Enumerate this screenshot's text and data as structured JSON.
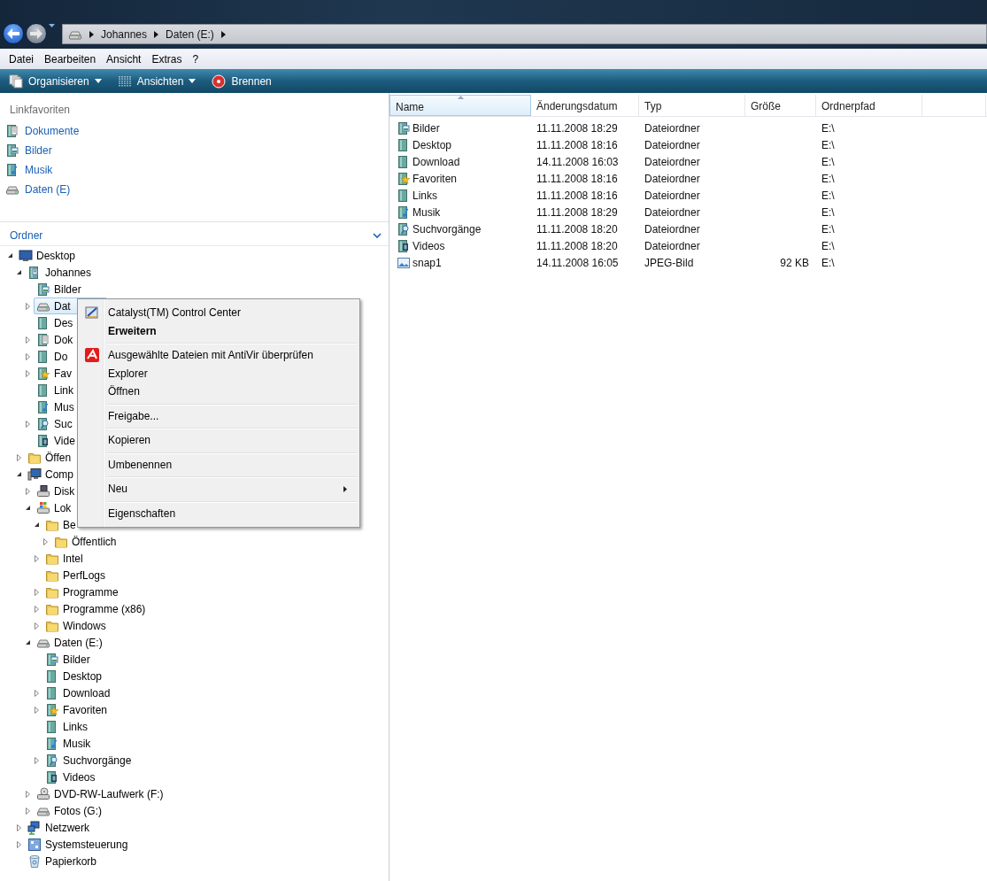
{
  "address_bar": {
    "crumbs": [
      "Johannes",
      "Daten (E:)"
    ]
  },
  "menu_bar": [
    "Datei",
    "Bearbeiten",
    "Ansicht",
    "Extras",
    "?"
  ],
  "toolbar": [
    {
      "label": "Organisieren",
      "kind": "organize",
      "dropdown": true
    },
    {
      "label": "Ansichten",
      "kind": "views",
      "dropdown": true
    },
    {
      "label": "Brennen",
      "kind": "burn",
      "dropdown": false
    }
  ],
  "favorite_links": {
    "title": "Linkfavoriten",
    "items": [
      {
        "label": "Dokumente",
        "kind": "docs"
      },
      {
        "label": "Bilder",
        "kind": "pictures"
      },
      {
        "label": "Musik",
        "kind": "music"
      },
      {
        "label": "Daten (E)",
        "kind": "drive"
      }
    ]
  },
  "folders": {
    "title": "Ordner",
    "tree": [
      {
        "label": "Desktop",
        "kind": "desktop",
        "expanded": true,
        "selected": false,
        "children": [
          {
            "label": "Johannes",
            "kind": "user",
            "expanded": true,
            "selected": false,
            "children": [
              {
                "label": "Bilder",
                "kind": "pictures",
                "selected": false
              },
              {
                "label": "Dat",
                "kind": "drive",
                "expanded": false,
                "selected": true
              },
              {
                "label": "Des",
                "kind": "library",
                "selected": false
              },
              {
                "label": "Dok",
                "kind": "docs",
                "expanded": false,
                "selected": false
              },
              {
                "label": "Do",
                "kind": "library",
                "expanded": false,
                "selected": false
              },
              {
                "label": "Fav",
                "kind": "favorites",
                "expanded": false,
                "selected": false
              },
              {
                "label": "Link",
                "kind": "library",
                "selected": false
              },
              {
                "label": "Mus",
                "kind": "music",
                "selected": false
              },
              {
                "label": "Suc",
                "kind": "search",
                "expanded": false,
                "selected": false
              },
              {
                "label": "Vide",
                "kind": "video",
                "selected": false
              }
            ]
          },
          {
            "label": "Öffen",
            "kind": "folder",
            "expanded": false,
            "selected": false
          },
          {
            "label": "Comp",
            "kind": "computer",
            "expanded": true,
            "selected": false,
            "children": [
              {
                "label": "Disk",
                "kind": "floppy",
                "expanded": false,
                "selected": false
              },
              {
                "label": "Lok",
                "kind": "windrive",
                "expanded": true,
                "selected": false,
                "children": [
                  {
                    "label": "Be",
                    "kind": "folder",
                    "expanded": true,
                    "selected": false,
                    "children": [
                      {
                        "label": "Öffentlich",
                        "kind": "folder",
                        "expanded": false,
                        "selected": false
                      }
                    ]
                  },
                  {
                    "label": "Intel",
                    "kind": "folder",
                    "expanded": false,
                    "selected": false
                  },
                  {
                    "label": "PerfLogs",
                    "kind": "folder",
                    "selected": false
                  },
                  {
                    "label": "Programme",
                    "kind": "folder",
                    "expanded": false,
                    "selected": false
                  },
                  {
                    "label": "Programme (x86)",
                    "kind": "folder",
                    "expanded": false,
                    "selected": false
                  },
                  {
                    "label": "Windows",
                    "kind": "folder",
                    "expanded": false,
                    "selected": false
                  }
                ]
              },
              {
                "label": "Daten (E:)",
                "kind": "drive",
                "expanded": true,
                "selected": false,
                "children": [
                  {
                    "label": "Bilder",
                    "kind": "pictures",
                    "selected": false
                  },
                  {
                    "label": "Desktop",
                    "kind": "library",
                    "selected": false
                  },
                  {
                    "label": "Download",
                    "kind": "library",
                    "expanded": false,
                    "selected": false
                  },
                  {
                    "label": "Favoriten",
                    "kind": "favorites",
                    "expanded": false,
                    "selected": false
                  },
                  {
                    "label": "Links",
                    "kind": "library",
                    "selected": false
                  },
                  {
                    "label": "Musik",
                    "kind": "music",
                    "selected": false
                  },
                  {
                    "label": "Suchvorgänge",
                    "kind": "search",
                    "expanded": false,
                    "selected": false
                  },
                  {
                    "label": "Videos",
                    "kind": "video",
                    "selected": false
                  }
                ]
              },
              {
                "label": "DVD-RW-Laufwerk (F:)",
                "kind": "dvd",
                "expanded": false,
                "selected": false
              },
              {
                "label": "Fotos (G:)",
                "kind": "drive",
                "expanded": false,
                "selected": false
              }
            ]
          },
          {
            "label": "Netzwerk",
            "kind": "network",
            "expanded": false,
            "selected": false
          },
          {
            "label": "Systemsteuerung",
            "kind": "control",
            "expanded": false,
            "selected": false
          },
          {
            "label": "Papierkorb",
            "kind": "bin",
            "selected": false
          }
        ]
      }
    ]
  },
  "file_list": {
    "columns": [
      {
        "label": "Name",
        "sorted": true
      },
      {
        "label": "Änderungsdatum",
        "sorted": false
      },
      {
        "label": "Typ",
        "sorted": false
      },
      {
        "label": "Größe",
        "sorted": false
      },
      {
        "label": "Ordnerpfad",
        "sorted": false
      }
    ],
    "rows": [
      {
        "kind": "pictures",
        "cells": [
          "Bilder",
          "11.11.2008 18:29",
          "Dateiordner",
          "",
          "E:\\"
        ]
      },
      {
        "kind": "library",
        "cells": [
          "Desktop",
          "11.11.2008 18:16",
          "Dateiordner",
          "",
          "E:\\"
        ]
      },
      {
        "kind": "library",
        "cells": [
          "Download",
          "14.11.2008 16:03",
          "Dateiordner",
          "",
          "E:\\"
        ]
      },
      {
        "kind": "favorites",
        "cells": [
          "Favoriten",
          "11.11.2008 18:16",
          "Dateiordner",
          "",
          "E:\\"
        ]
      },
      {
        "kind": "library",
        "cells": [
          "Links",
          "11.11.2008 18:16",
          "Dateiordner",
          "",
          "E:\\"
        ]
      },
      {
        "kind": "music",
        "cells": [
          "Musik",
          "11.11.2008 18:29",
          "Dateiordner",
          "",
          "E:\\"
        ]
      },
      {
        "kind": "search",
        "cells": [
          "Suchvorgänge",
          "11.11.2008 18:20",
          "Dateiordner",
          "",
          "E:\\"
        ]
      },
      {
        "kind": "video",
        "cells": [
          "Videos",
          "11.11.2008 18:20",
          "Dateiordner",
          "",
          "E:\\"
        ]
      },
      {
        "kind": "image",
        "cells": [
          "snap1",
          "14.11.2008 16:05",
          "JPEG-Bild",
          "92 KB",
          "E:\\"
        ]
      }
    ]
  },
  "context_menu": {
    "groups": [
      [
        {
          "label": "Catalyst(TM) Control Center",
          "kind": "catalyst",
          "bold": false,
          "submenu": false
        },
        {
          "label": "Erweitern",
          "bold": true,
          "submenu": false
        }
      ],
      [
        {
          "label": "Ausgewählte Dateien mit AntiVir überprüfen",
          "kind": "antivir",
          "bold": false,
          "submenu": false
        },
        {
          "label": "Explorer",
          "bold": false,
          "submenu": false
        },
        {
          "label": "Öffnen",
          "bold": false,
          "submenu": false
        }
      ],
      [
        {
          "label": "Freigabe...",
          "bold": false,
          "submenu": false
        }
      ],
      [
        {
          "label": "Kopieren",
          "bold": false,
          "submenu": false
        }
      ],
      [
        {
          "label": "Umbenennen",
          "bold": false,
          "submenu": false
        }
      ],
      [
        {
          "label": "Neu",
          "bold": false,
          "submenu": true
        }
      ],
      [
        {
          "label": "Eigenschaften",
          "bold": false,
          "submenu": false
        }
      ]
    ]
  }
}
